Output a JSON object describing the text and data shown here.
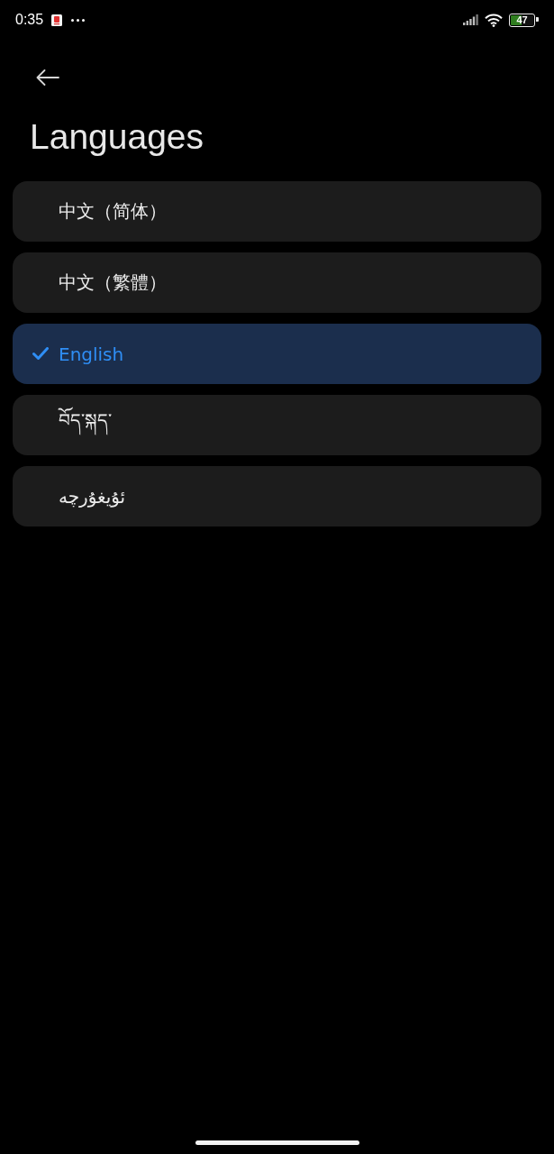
{
  "status_bar": {
    "time": "0:35",
    "battery_text": "47"
  },
  "header": {
    "title": "Languages"
  },
  "languages": [
    {
      "label": "中文（简体）",
      "selected": false
    },
    {
      "label": "中文（繁體）",
      "selected": false
    },
    {
      "label": "English",
      "selected": true
    },
    {
      "label": "བོད་སྐད་",
      "selected": false
    },
    {
      "label": "ئۇيغۇرچە",
      "selected": false
    }
  ]
}
